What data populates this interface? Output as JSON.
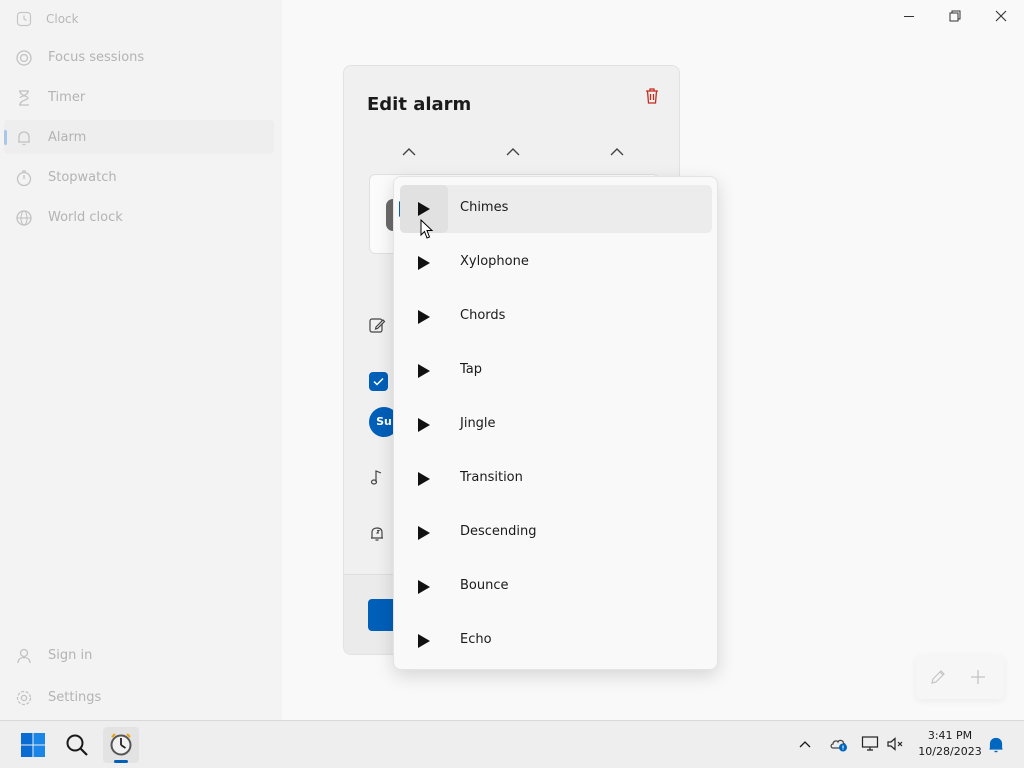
{
  "app": {
    "title": "Clock"
  },
  "sidebar": {
    "items": [
      {
        "label": "Focus sessions",
        "icon": "focus-icon"
      },
      {
        "label": "Timer",
        "icon": "hourglass-icon"
      },
      {
        "label": "Alarm",
        "icon": "bell-icon",
        "active": true
      },
      {
        "label": "Stopwatch",
        "icon": "stopwatch-icon"
      },
      {
        "label": "World clock",
        "icon": "globe-icon"
      }
    ],
    "bottom": [
      {
        "label": "Sign in",
        "icon": "person-icon"
      },
      {
        "label": "Settings",
        "icon": "gear-icon"
      }
    ]
  },
  "dialog": {
    "title": "Edit alarm",
    "repeat_day_badge": "Su"
  },
  "sound_menu": {
    "selected": "Chimes",
    "options": [
      "Chimes",
      "Xylophone",
      "Chords",
      "Tap",
      "Jingle",
      "Transition",
      "Descending",
      "Bounce",
      "Echo"
    ]
  },
  "taskbar": {
    "time": "3:41 PM",
    "date": "10/28/2023"
  },
  "colors": {
    "accent": "#005fb8",
    "delete": "#c42b1c"
  }
}
